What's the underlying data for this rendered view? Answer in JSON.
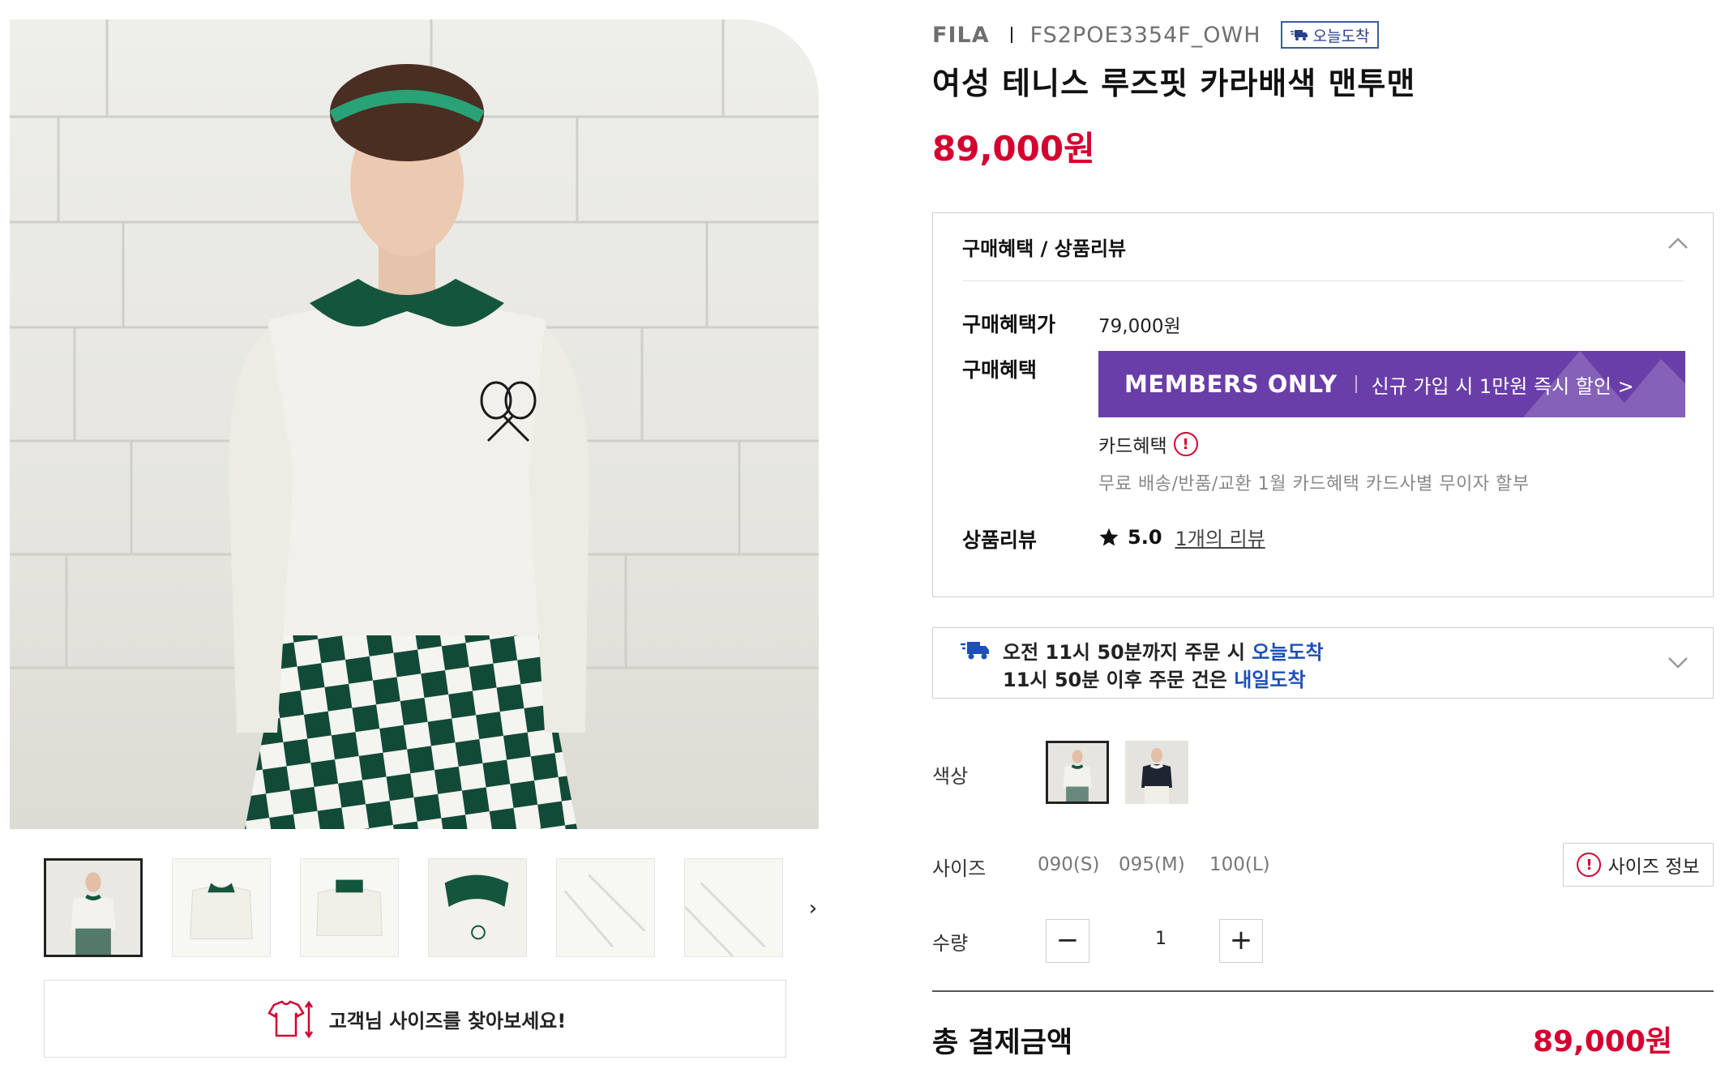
{
  "product": {
    "brand": "FILA",
    "sku": "FS2POE3354F_OWH",
    "today_badge": "오늘도착",
    "title": "여성 테니스 루즈핏 카라배색 맨투맨",
    "price": "89,000원"
  },
  "benefits": {
    "header": "구매혜택 / 상품리뷰",
    "price_label": "구매혜택가",
    "price_value": "79,000원",
    "benefit_label": "구매혜택",
    "members_title": "MEMBERS ONLY",
    "members_text": "신규 가입 시 1만원 즉시 할인 >",
    "card_label": "카드혜택",
    "card_desc": "무료 배송/반품/교환 1월 카드혜택 카드사별 무이자 할부",
    "review_label": "상품리뷰",
    "review_score": "5.0",
    "review_link": "1개의 리뷰"
  },
  "delivery": {
    "line1_prefix": "오전 11시 50분까지 주문 시 ",
    "line1_highlight": "오늘도착",
    "line2_prefix": "11시 50분 이후 주문 건은 ",
    "line2_highlight": "내일도착"
  },
  "options": {
    "color_label": "색상",
    "size_label": "사이즈",
    "sizes": [
      "090(S)",
      "095(M)",
      "100(L)"
    ],
    "size_info": "사이즈 정보",
    "quantity_label": "수량",
    "quantity": "1",
    "minus": "−",
    "plus": "+"
  },
  "total": {
    "label": "총 결제금액",
    "price": "89,000원"
  },
  "gallery": {
    "next": "›",
    "size_finder": "고객님 사이즈를 찾아보세요!"
  },
  "colors": {
    "price_red": "#d4002f",
    "members_purple": "#6a3ea8",
    "delivery_blue": "#1e4fb8",
    "collar_green": "#14553e"
  },
  "icons": [
    "truck-icon",
    "chevron-up-icon",
    "chevron-down-icon",
    "star-icon",
    "alert-icon",
    "tshirt-size-icon",
    "chevron-right-icon"
  ]
}
